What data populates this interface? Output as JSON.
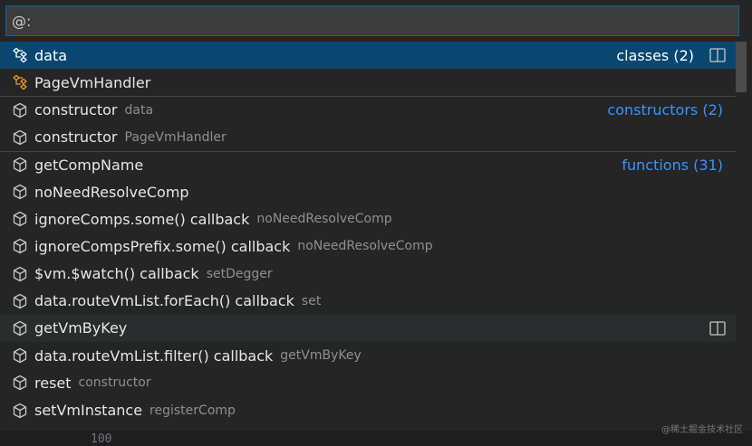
{
  "input": {
    "value": "@:"
  },
  "rows": [
    {
      "label": "data",
      "desc": "",
      "group": "classes (2)",
      "icon": "class-icon",
      "selected": true,
      "split": true
    },
    {
      "label": "PageVmHandler",
      "desc": "",
      "group": "",
      "icon": "class-icon"
    },
    {
      "label": "constructor",
      "desc": "data",
      "group": "constructors (2)",
      "icon": "method-icon",
      "sep": true
    },
    {
      "label": "constructor",
      "desc": "PageVmHandler",
      "group": "",
      "icon": "method-icon"
    },
    {
      "label": "getCompName",
      "desc": "",
      "group": "functions (31)",
      "icon": "method-icon",
      "sep": true
    },
    {
      "label": "noNeedResolveComp",
      "desc": "",
      "group": "",
      "icon": "method-icon"
    },
    {
      "label": "ignoreComps.some() callback",
      "desc": "noNeedResolveComp",
      "group": "",
      "icon": "method-icon"
    },
    {
      "label": "ignoreCompsPrefix.some() callback",
      "desc": "noNeedResolveComp",
      "group": "",
      "icon": "method-icon"
    },
    {
      "label": "$vm.$watch() callback",
      "desc": "setDegger",
      "group": "",
      "icon": "method-icon"
    },
    {
      "label": "data.routeVmList.forEach() callback",
      "desc": "set",
      "group": "",
      "icon": "method-icon"
    },
    {
      "label": "getVmByKey",
      "desc": "",
      "group": "",
      "icon": "method-icon",
      "hover": true,
      "split": true
    },
    {
      "label": "data.routeVmList.filter() callback",
      "desc": "getVmByKey",
      "group": "",
      "icon": "method-icon"
    },
    {
      "label": "reset",
      "desc": "constructor",
      "group": "",
      "icon": "method-icon"
    },
    {
      "label": "setVmInstance",
      "desc": "registerComp",
      "group": "",
      "icon": "method-icon"
    }
  ],
  "editor": {
    "line_number": "100"
  },
  "watermark": "@稀土掘金技术社区",
  "colors": {
    "selection": "#094771",
    "accent": "#3794ff",
    "class_icon": "#ee9d28",
    "method_icon": "#b180d7"
  }
}
